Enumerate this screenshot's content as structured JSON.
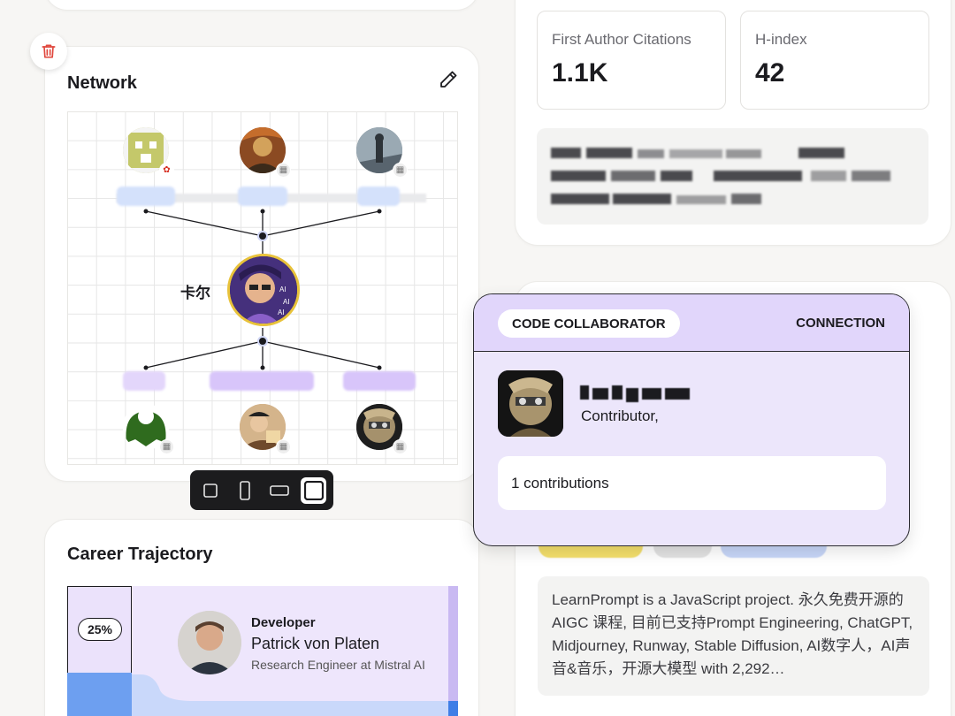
{
  "network": {
    "title": "Network",
    "center_name": "卡尔"
  },
  "toolbar": {
    "modes": [
      "small-square",
      "portrait",
      "landscape",
      "large-square"
    ],
    "active": "large-square"
  },
  "career": {
    "title": "Career Trajectory",
    "percent": "25%",
    "role": "Developer",
    "name": "Patrick von Platen",
    "subtitle": "Research Engineer at Mistral AI"
  },
  "stats": {
    "citations_label": "First Author Citations",
    "citations_value": "1.1K",
    "hindex_label": "H-index",
    "hindex_value": "42"
  },
  "popup": {
    "type_label": "CODE COLLABORATOR",
    "connection_label": "CONNECTION",
    "role": "Contributor,",
    "contributions": "1 contributions"
  },
  "repo": {
    "description": "LearnPrompt is a JavaScript project. 永久免费开源的 AIGC 课程, 目前已支持Prompt Engineering, ChatGPT, Midjourney, Runway, Stable Diffusion, AI数字人，AI声音&音乐，开源大模型 with 2,292…",
    "tag_colors": [
      "#f4df6b",
      "#e2e2e2",
      "#c7d6f8"
    ]
  },
  "colors": {
    "accent_lilac": "#ece6fb",
    "gold_ring": "#e8c23a",
    "trash_red": "#e0483e"
  }
}
